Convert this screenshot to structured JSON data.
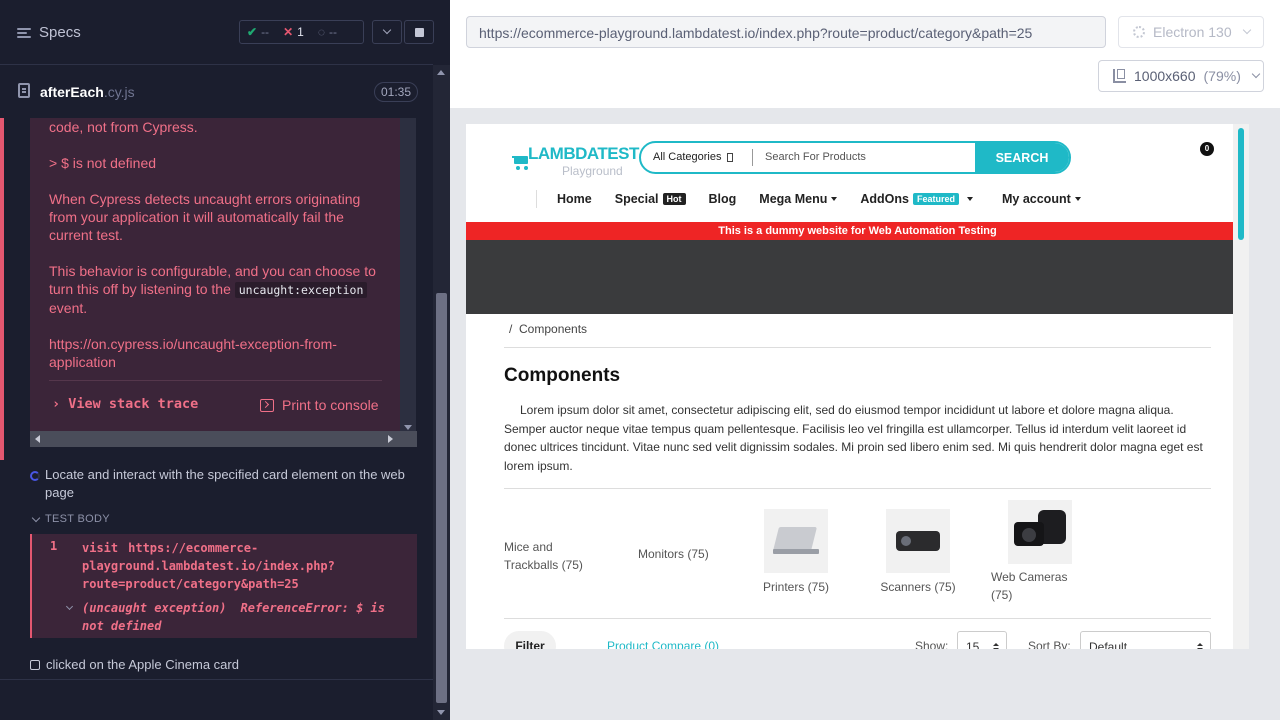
{
  "runner": {
    "header": {
      "specs_label": "Specs",
      "passed": "--",
      "failed": "1",
      "pending": "--"
    },
    "file": {
      "name": "afterEach",
      "ext": ".cy.js",
      "duration": "01:35"
    },
    "error": {
      "line1": "code, not from Cypress.",
      "line2": "> $ is not defined",
      "line3": "When Cypress detects uncaught errors originating from your application it will automatically fail the current test.",
      "line4_pre": "This behavior is configurable, and you can choose to turn this off by listening to the ",
      "line4_code": "uncaught:exception",
      "line4_post": " event.",
      "line5": "https://on.cypress.io/uncaught-exception-from-application",
      "view_stack": "View stack trace",
      "print_console": "Print to console"
    },
    "test1_title": "Locate and interact with the specified card element on the web page",
    "test_body_label": "TEST BODY",
    "command": {
      "num": "1",
      "name": "visit",
      "url": "https://ecommerce-playground.lambdatest.io/index.php?route=product/category&path=25",
      "err_tag": "(uncaught exception)",
      "err_msg": "ReferenceError: $ is not defined"
    },
    "test2_title": "clicked on the Apple Cinema card"
  },
  "browser": {
    "url": "https://ecommerce-playground.lambdatest.io/index.php?route=product/category&path=25",
    "engine": "Electron 130",
    "viewport": "1000x660",
    "viewport_pct": "(79%)"
  },
  "site": {
    "logo_brand": "LAMBDATEST",
    "logo_sub": "Playground",
    "search_category": "All Categories",
    "search_placeholder": "Search For Products",
    "search_button": "SEARCH",
    "cart_count": "0",
    "nav": {
      "home": "Home",
      "special": "Special",
      "special_badge": "Hot",
      "blog": "Blog",
      "mega": "Mega Menu",
      "addons": "AddOns",
      "addons_badge": "Featured",
      "account": "My account"
    },
    "banner": "This is a dummy website for Web Automation Testing",
    "breadcrumb": "Components",
    "page_title": "Components",
    "description": "Lorem ipsum dolor sit amet, consectetur adipiscing elit, sed do eiusmod tempor incididunt ut labore et dolore magna aliqua. Semper auctor neque vitae tempus quam pellentesque. Facilisis leo vel fringilla est ullamcorper. Tellus id interdum velit laoreet id donec ultrices tincidunt. Vitae nunc sed velit dignissim sodales. Mi proin sed libero enim sed. Mi quis hendrerit dolor magna eget est lorem ipsum.",
    "categories": [
      {
        "name": "Mice and Trackballs (75)"
      },
      {
        "name": "Monitors (75)"
      },
      {
        "name": "Printers (75)"
      },
      {
        "name": "Scanners (75)"
      },
      {
        "name": "Web Cameras (75)"
      }
    ],
    "toolbar": {
      "filter": "Filter",
      "compare": "Product Compare (0)",
      "show_label": "Show:",
      "show_value": "15",
      "sort_label": "Sort By:",
      "sort_value": "Default"
    }
  }
}
